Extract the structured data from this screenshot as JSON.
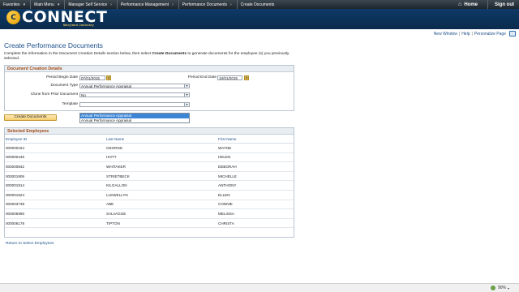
{
  "topnav": {
    "crumbs": [
      {
        "label": "Favorites"
      },
      {
        "label": "Main Menu"
      },
      {
        "label": "Manager Self Service"
      },
      {
        "label": "Performance Management"
      },
      {
        "label": "Performance Documents"
      },
      {
        "label": "Create Documents"
      }
    ],
    "home_label": "Home",
    "signout_label": "Sign out"
  },
  "banner": {
    "logo_letter": "C",
    "logo_word": "CONNECT",
    "logo_sub": "Maryland Judiciary"
  },
  "utilbar": {
    "links": [
      "New Window",
      "Help",
      "Personalize Page"
    ]
  },
  "page": {
    "title": "Create Performance Documents",
    "instruction_prefix": "Complete the information in the ",
    "instruction_em": "Document Creation Details",
    "instruction_mid": " section below, then select ",
    "instruction_bold": "Create Documents",
    "instruction_suffix": " to generate documents for the employee (s) you previously selected."
  },
  "creation": {
    "header": "Document Creation Details",
    "period_begin_label": "Period Begin Date",
    "period_begin_value": "07/01/2015",
    "period_end_label": "Period End Date",
    "period_end_value": "10/01/2015",
    "doc_type_label": "Document Type",
    "doc_type_value": "Annual Performance Appraisal",
    "clone_label": "Clone from Prior Document",
    "clone_value": "No",
    "template_label": "Template",
    "template_value": "",
    "template_options": [
      "Annual Performance Appraisal",
      "Annual Performance Appraisal"
    ]
  },
  "create_button_label": "Create Documents",
  "employees": {
    "header": "Selected Employees",
    "columns": [
      "Employee ID",
      "Last Name",
      "First Name"
    ],
    "rows": [
      [
        "000000154",
        "GEORGE",
        "WAYNE"
      ],
      [
        "000000446",
        "HOTT",
        "HELEN"
      ],
      [
        "000000842",
        "WHITAKER",
        "DEBORAH"
      ],
      [
        "000001906",
        "STRIETBECK",
        "MICHELLE"
      ],
      [
        "000001914",
        "KILGALLON",
        "ANTHONY"
      ],
      [
        "000001924",
        "LLEWELLYN",
        "ELLEN"
      ],
      [
        "000003738",
        "ABE",
        "CONNIE"
      ],
      [
        "000005990",
        "SALVAGGE",
        "MELISSA"
      ],
      [
        "000006178",
        "TIPTON",
        "CHRISTA"
      ]
    ]
  },
  "return_link": "Return to Select Employees",
  "statusbar": {
    "zoom": "90%"
  }
}
